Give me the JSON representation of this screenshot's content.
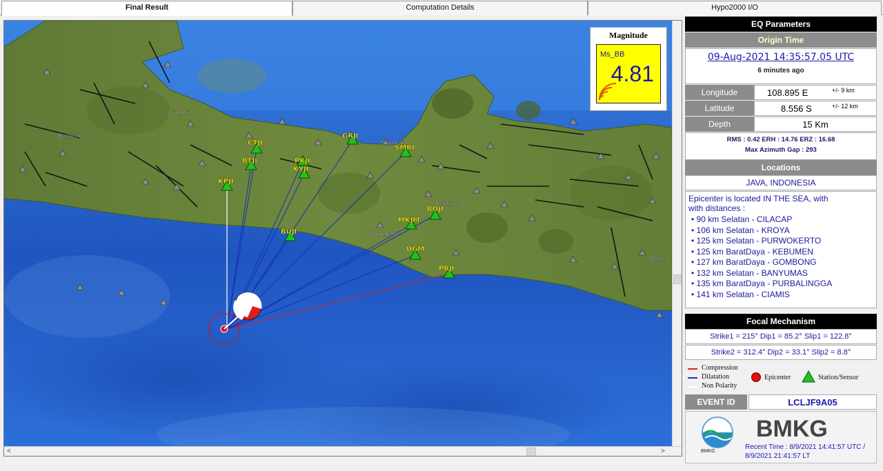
{
  "tabs": [
    {
      "label": "Final Result",
      "active": true
    },
    {
      "label": "Computation Details",
      "active": false
    },
    {
      "label": "Hypo2000 I/O",
      "active": false
    }
  ],
  "map": {
    "stations": [
      {
        "code": "CTJI"
      },
      {
        "code": "BTJI"
      },
      {
        "code": "PKJI"
      },
      {
        "code": "KYJI"
      },
      {
        "code": "GRJI"
      },
      {
        "code": "SMRI"
      },
      {
        "code": "KPJI"
      },
      {
        "code": "BUJI"
      },
      {
        "code": "BOJI"
      },
      {
        "code": "MKJM"
      },
      {
        "code": "UGM"
      },
      {
        "code": "PBJI"
      }
    ],
    "cities": [
      "Cirebon",
      "Bandung",
      "Semarang",
      "Surakarta",
      "Yogyakarta",
      "Malan"
    ]
  },
  "magnitude": {
    "title": "Magnitude",
    "type": "Ms_BB",
    "value": "4.81"
  },
  "eq": {
    "header": "EQ Parameters",
    "origin_label": "Origin Time",
    "origin_time": "09-Aug-2021 14:35:57.05 UTC",
    "ago": "6 minutes  ago",
    "longitude_label": "Longitude",
    "longitude": "108.895 E",
    "longitude_err": "+/-  9 km",
    "latitude_label": "Latitude",
    "latitude": "8.556 S",
    "latitude_err": "+/-  12 km",
    "depth_label": "Depth",
    "depth": "15 Km",
    "stats_line1": "RMS : 0.42   ERH : 14.76   ERZ : 16.68",
    "stats_line2": "Max Azimuth Gap : 293"
  },
  "locations": {
    "header": "Locations",
    "region": "JAVA, INDONESIA",
    "intro1": "Epicenter is located IN THE SEA, with",
    "intro2": "with distances :",
    "items": [
      "90 km Selatan - CILACAP",
      "106 km Selatan - KROYA",
      "125 km Selatan - PURWOKERTO",
      "125 km BaratDaya - KEBUMEN",
      "127 km BaratDaya - GOMBONG",
      "132 km Selatan - BANYUMAS",
      "135 km BaratDaya - PURBALINGGA",
      "141 km Selatan - CIAMIS"
    ]
  },
  "focal": {
    "header": "Focal Mechanism",
    "line1": "Strike1 = 215° Dip1 = 85.2° Slip1 = 122.8°",
    "line2": "Strike2 = 312.4° Dip2 = 33.1° Slip2 = 8.8°"
  },
  "legend": {
    "compression": "Compression",
    "dilatation": "Dilatation",
    "non_polarity": "Non Polarity",
    "epicenter": "Epicenter",
    "station": "Station/Sensor",
    "compression_color": "#e02020",
    "dilatation_color": "#1a2fb5",
    "non_polarity_color": "#ffffff"
  },
  "event": {
    "label": "EVENT ID",
    "id": "LCLJF9A05"
  },
  "footer": {
    "brand": "BMKG",
    "logo_text": "BMKG",
    "recent1": "Recent Time : 8/9/2021 14:41:57 UTC /",
    "recent2": "8/9/2021 21:41:57 LT"
  }
}
